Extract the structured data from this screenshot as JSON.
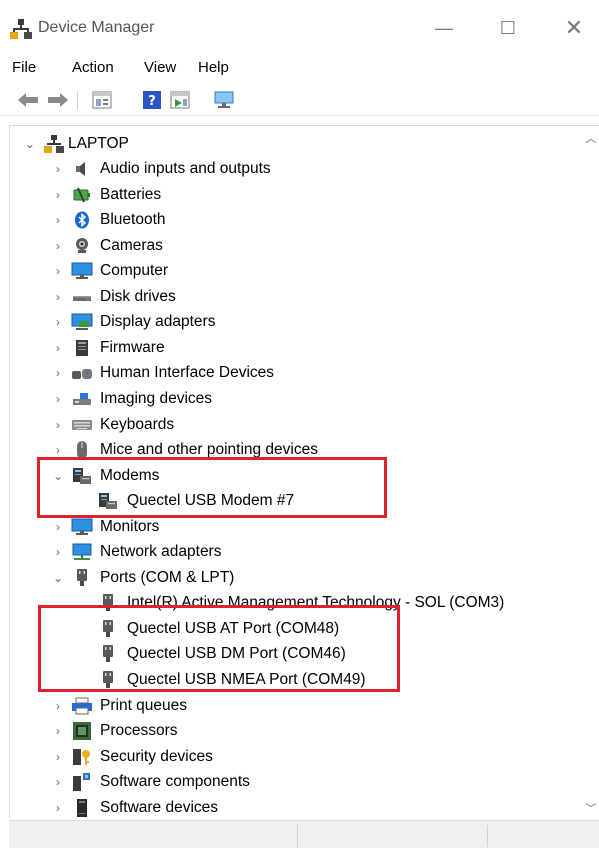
{
  "window": {
    "title": "Device Manager",
    "minimize_glyph": "—",
    "maximize_glyph": "☐",
    "close_glyph": "✕"
  },
  "menu": [
    "File",
    "Action",
    "View",
    "Help"
  ],
  "toolbar": [
    "back-arrow-icon",
    "forward-arrow-icon",
    "properties-icon",
    "help-icon",
    "update-driver-icon",
    "scan-hardware-icon"
  ],
  "tree": {
    "root": "LAPTOP",
    "items": [
      {
        "label": "Audio inputs and outputs",
        "icon": "speaker-icon",
        "level": 1,
        "expanded": false
      },
      {
        "label": "Batteries",
        "icon": "battery-icon",
        "level": 1,
        "expanded": false
      },
      {
        "label": "Bluetooth",
        "icon": "bluetooth-icon",
        "level": 1,
        "expanded": false
      },
      {
        "label": "Cameras",
        "icon": "camera-icon",
        "level": 1,
        "expanded": false
      },
      {
        "label": "Computer",
        "icon": "monitor-icon",
        "level": 1,
        "expanded": false
      },
      {
        "label": "Disk drives",
        "icon": "disk-drive-icon",
        "level": 1,
        "expanded": false
      },
      {
        "label": "Display adapters",
        "icon": "display-adapter-icon",
        "level": 1,
        "expanded": false
      },
      {
        "label": "Firmware",
        "icon": "firmware-icon",
        "level": 1,
        "expanded": false
      },
      {
        "label": "Human Interface Devices",
        "icon": "hid-icon",
        "level": 1,
        "expanded": false
      },
      {
        "label": "Imaging devices",
        "icon": "imaging-icon",
        "level": 1,
        "expanded": false
      },
      {
        "label": "Keyboards",
        "icon": "keyboard-icon",
        "level": 1,
        "expanded": false
      },
      {
        "label": "Mice and other pointing devices",
        "icon": "mouse-icon",
        "level": 1,
        "expanded": false
      },
      {
        "label": "Modems",
        "icon": "modem-icon",
        "level": 1,
        "expanded": true
      },
      {
        "label": "Quectel USB Modem #7",
        "icon": "modem-icon",
        "level": 2
      },
      {
        "label": "Monitors",
        "icon": "monitor-icon",
        "level": 1,
        "expanded": false
      },
      {
        "label": "Network adapters",
        "icon": "network-icon",
        "level": 1,
        "expanded": false
      },
      {
        "label": "Ports (COM & LPT)",
        "icon": "port-icon",
        "level": 1,
        "expanded": true
      },
      {
        "label": "Intel(R) Active Management Technology - SOL (COM3)",
        "icon": "port-icon",
        "level": 2
      },
      {
        "label": "Quectel USB AT Port (COM48)",
        "icon": "port-icon",
        "level": 2
      },
      {
        "label": "Quectel USB DM Port (COM46)",
        "icon": "port-icon",
        "level": 2
      },
      {
        "label": "Quectel USB NMEA Port (COM49)",
        "icon": "port-icon",
        "level": 2
      },
      {
        "label": "Print queues",
        "icon": "printer-icon",
        "level": 1,
        "expanded": false
      },
      {
        "label": "Processors",
        "icon": "processor-icon",
        "level": 1,
        "expanded": false
      },
      {
        "label": "Security devices",
        "icon": "security-icon",
        "level": 1,
        "expanded": false
      },
      {
        "label": "Software components",
        "icon": "software-component-icon",
        "level": 1,
        "expanded": false
      },
      {
        "label": "Software devices",
        "icon": "software-device-icon",
        "level": 1,
        "expanded": false
      }
    ]
  },
  "annotations": {
    "highlight_color": "#e0202c"
  }
}
